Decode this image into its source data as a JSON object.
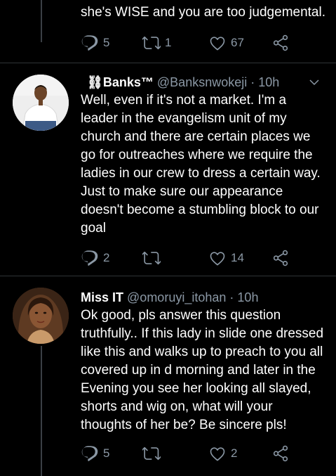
{
  "tweets": [
    {
      "text": "she's WISE and you are too judgemental.",
      "reply_count": "5",
      "retweet_count": "1",
      "like_count": "67"
    },
    {
      "name": " ⛓Banks™",
      "handle": "@Banksnwokeji",
      "dot": "·",
      "time": "10h",
      "text": "Well, even if it's not a market. I'm a leader in the evangelism unit of my church and there are certain places we go for outreaches where we require the ladies in our crew to dress a certain way. Just to make sure our appearance doesn't become a stumbling block to our goal",
      "reply_count": "2",
      "retweet_count": "",
      "like_count": "14"
    },
    {
      "name": "Miss IT",
      "handle": "@omoruyi_itohan",
      "dot": "·",
      "time": "10h",
      "text": "Ok good, pls answer this question truthfully.. If this lady in slide one dressed like this and walks up to preach to you all covered up in d morning and later in the Evening you see her looking all slayed, shorts and wig on, what will your thoughts of her be? Be sincere pls!",
      "reply_count": "5",
      "retweet_count": "",
      "like_count": "2"
    }
  ],
  "icons": {
    "reply": "reply-icon",
    "retweet": "retweet-icon",
    "like": "like-icon",
    "share": "share-icon",
    "caret": "chevron-down-icon"
  },
  "colors": {
    "background": "#000000",
    "muted": "#8b98a5",
    "divider": "#2f3336"
  }
}
